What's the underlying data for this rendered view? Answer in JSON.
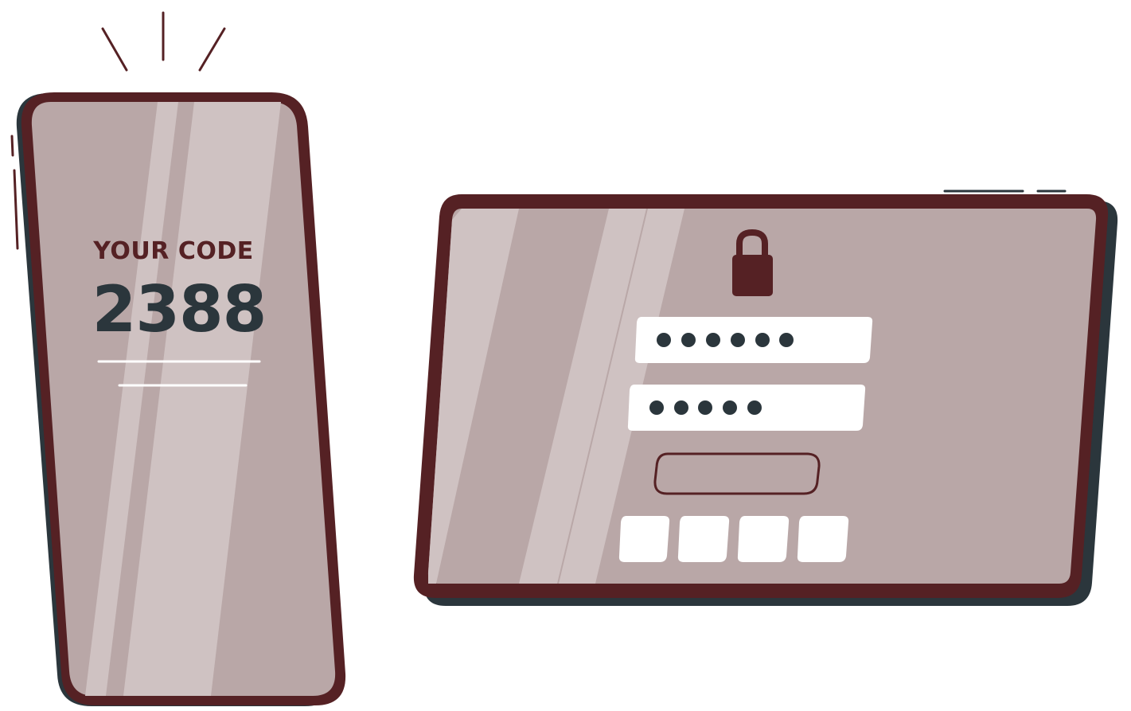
{
  "colors": {
    "frame": "#552124",
    "shadow": "#2b363c",
    "screen": "#b9a7a7",
    "screen_highlight": "#cfc2c2",
    "white": "#ffffff",
    "dark_text": "#2b363c",
    "accent_text": "#552124"
  },
  "phone": {
    "label": "YOUR CODE",
    "code": "2388",
    "notification_icon": "ping-lines-icon"
  },
  "tablet": {
    "lock_icon": "padlock-icon",
    "username_masked": "••••••",
    "password_masked": "•••••",
    "submit_icon": "empty-button",
    "code_boxes": [
      "",
      "",
      "",
      ""
    ]
  }
}
